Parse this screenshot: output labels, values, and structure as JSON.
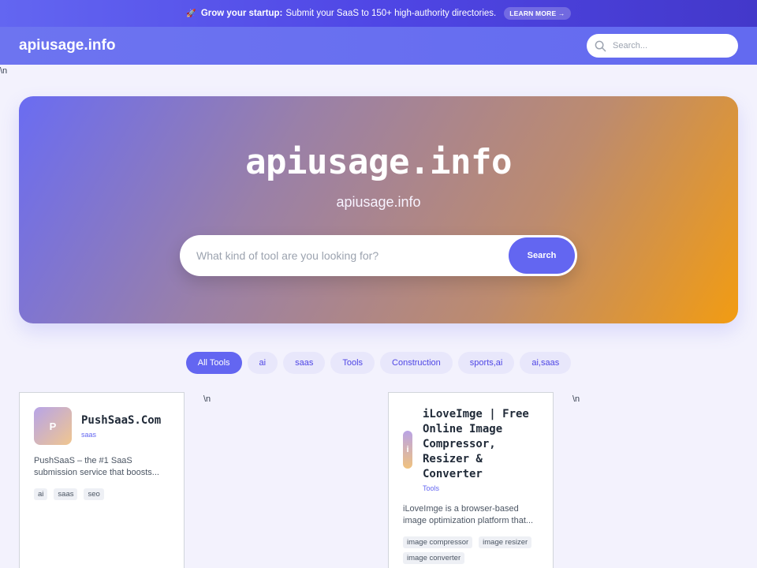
{
  "promo": {
    "icon": "rocket-icon",
    "bold": "Grow your startup:",
    "text": "Submit your SaaS to 150+ high-authority directories.",
    "cta": "LEARN MORE →"
  },
  "header": {
    "logo": "apiusage.info",
    "search_placeholder": "Search..."
  },
  "stray_text": "\\n",
  "hero": {
    "title": "apiusage.info",
    "subtitle": "apiusage.info",
    "search_placeholder": "What kind of tool are you looking for?",
    "search_button": "Search"
  },
  "filters": [
    {
      "label": "All Tools",
      "active": true
    },
    {
      "label": "ai",
      "active": false
    },
    {
      "label": "saas",
      "active": false
    },
    {
      "label": "Tools",
      "active": false
    },
    {
      "label": "Construction",
      "active": false
    },
    {
      "label": "sports,ai",
      "active": false
    },
    {
      "label": "ai,saas",
      "active": false
    }
  ],
  "cards": [
    {
      "avatar_letter": "P",
      "title": "PushSaaS.Com",
      "category": "saas",
      "description": "PushSaaS – the #1 SaaS submission service that boosts...",
      "tags": [
        "ai",
        "saas",
        "seo"
      ]
    },
    {
      "avatar_letter": "i",
      "title": "iLoveImge | Free Online Image Compressor, Resizer & Converter",
      "category": "Tools",
      "description": "iLoveImge is a browser-based image optimization platform that...",
      "tags": [
        "image compressor",
        "image resizer",
        "image converter"
      ]
    }
  ],
  "colors": {
    "accent": "#6366f1",
    "hero_gradient_start": "#6a6cf2",
    "hero_gradient_end": "#f29c12",
    "page_bg": "#f3f2fd"
  }
}
